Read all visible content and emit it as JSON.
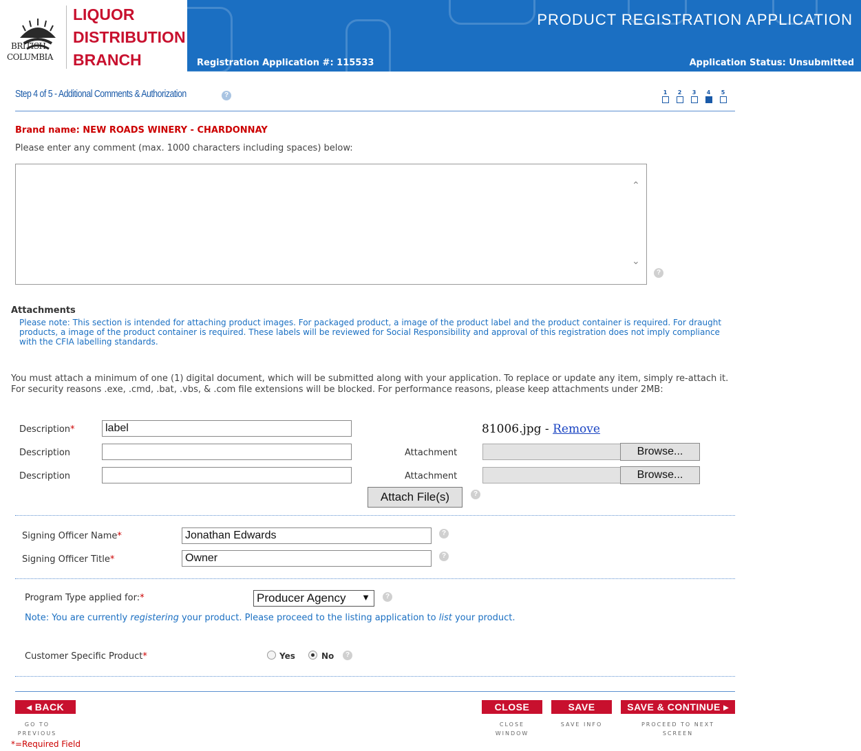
{
  "header": {
    "org_name_line1": "LIQUOR",
    "org_name_line2": "DISTRIBUTION",
    "org_name_line3": "BRANCH",
    "logo_text_line1": "BRITISH",
    "logo_text_line2": "COLUMBIA",
    "app_title": "PRODUCT REGISTRATION APPLICATION",
    "registration_number": "Registration Application #: 115533",
    "application_status": "Application Status: Unsubmitted"
  },
  "step": {
    "title": "Step 4 of 5 - Additional Comments & Authorization",
    "indicators": [
      "1",
      "2",
      "3",
      "4",
      "5"
    ],
    "current": 4
  },
  "brand_name": "Brand name: NEW ROADS WINERY - CHARDONNAY",
  "comment": {
    "label": "Please enter any comment (max. 1000 characters including spaces) below:",
    "value": ""
  },
  "attachments": {
    "title": "Attachments",
    "note": "Please note: This section is intended for attaching product images. For packaged product, a image of the product label and the product container is required. For draught products, a image of the product container is required. These labels will be reviewed for Social Responsibility and approval of this registration does not imply compliance with the CFIA labelling standards.",
    "requirement": "You must attach a minimum of one (1) digital document, which will be submitted along with your application. To replace or update any item, simply re-attach it. For security reasons .exe, .cmd, .bat, .vbs, & .com file extensions will be blocked. For performance reasons, please keep attachments under 2MB:",
    "description_label": "Description",
    "attachment_label": "Attachment",
    "browse_label": "Browse...",
    "rows": [
      {
        "description": "label",
        "file": "81006.jpg - ",
        "remove": "Remove"
      },
      {
        "description": "",
        "file": ""
      },
      {
        "description": "",
        "file": ""
      }
    ],
    "attach_button": "Attach File(s)"
  },
  "signing": {
    "name_label": "Signing Officer Name",
    "name_value": "Jonathan Edwards",
    "title_label": "Signing Officer Title",
    "title_value": "Owner"
  },
  "program": {
    "label": "Program Type applied for:",
    "selected": "Producer Agency",
    "note_part1": "Note: You are currently ",
    "note_em1": "registering",
    "note_part2": " your product. Please proceed to the listing application to ",
    "note_em2": "list",
    "note_part3": " your product."
  },
  "customer_specific": {
    "label": "Customer Specific Product",
    "options": [
      "Yes",
      "No"
    ],
    "selected": "No"
  },
  "buttons": {
    "back": "◂ BACK",
    "back_caption": "GO TO PREVIOUS",
    "close": "CLOSE",
    "close_caption": "CLOSE WINDOW",
    "save": "SAVE",
    "save_caption": "SAVE INFO",
    "save_continue": "SAVE & CONTINUE ▸",
    "save_continue_caption": "PROCEED TO NEXT SCREEN"
  },
  "required_marker": "*",
  "required_note": "*=Required Field",
  "colors": {
    "banner": "#1b6fc2",
    "brand_red": "#c8102e",
    "link_blue": "#1a6fc2"
  }
}
